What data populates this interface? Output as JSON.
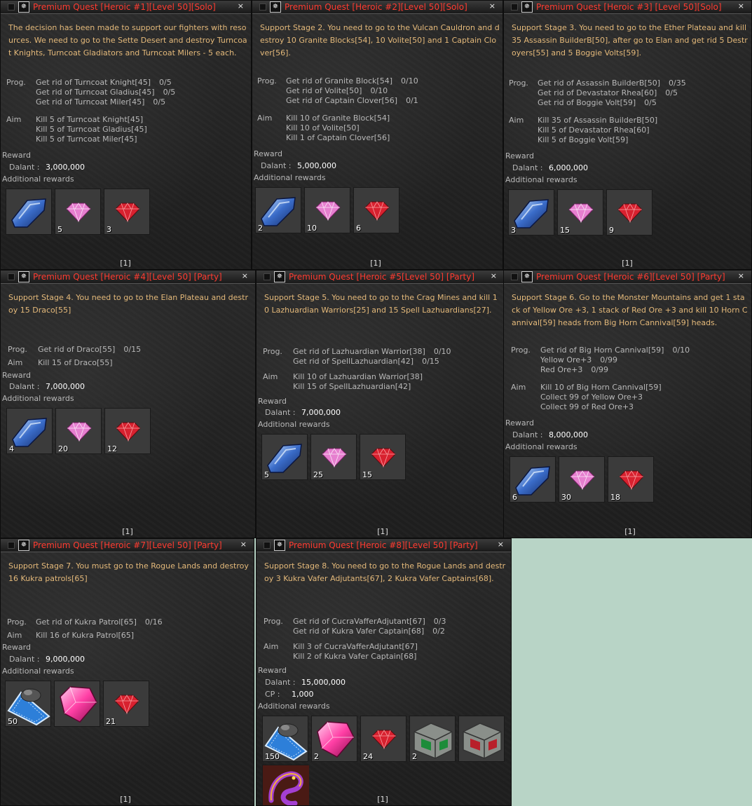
{
  "quests": [
    {
      "title": "Premium Quest [Heroic #1][Level 50][Solo]",
      "description": "The decision has been made to support our fighters with resources. We need to go to the Sette Desert and destroy Turncoat Knights, Turncoat Gladiators and Turncoat Milers - 5 each.",
      "prog_label": "Prog.",
      "progress": [
        {
          "text": "Get rid of Turncoat Knight[45]",
          "count": "0/5"
        },
        {
          "text": "Get rid of Turncoat Gladius[45]",
          "count": "0/5"
        },
        {
          "text": "Get rid of Turncoat Miler[45]",
          "count": "0/5"
        }
      ],
      "aim_label": "Aim",
      "aims": [
        "Kill 5 of Turncoat Knight[45]",
        "Kill 5 of Turncoat Gladius[45]",
        "Kill 5 of Turncoat Miler[45]"
      ],
      "reward_label": "Reward",
      "dalant_label": "Dalant :",
      "dalant": "3,000,000",
      "additional_label": "Additional rewards",
      "items": [
        {
          "icon": "blue-crystal-icon",
          "qty": ""
        },
        {
          "icon": "pink-gem-icon",
          "qty": "5"
        },
        {
          "icon": "red-gem-icon",
          "qty": "3"
        }
      ],
      "page": "[1]",
      "close": "×"
    },
    {
      "title": "Premium Quest [Heroic #2][Level 50][Solo]",
      "description": "Support Stage 2. You need to go to the Vulcan Cauldron and destroy 10 Granite Blocks[54], 10 Volite[50] and 1 Captain Clover[56].",
      "prog_label": "Prog.",
      "progress": [
        {
          "text": "Get rid of Granite Block[54]",
          "count": "0/10"
        },
        {
          "text": "Get rid of Volite[50]",
          "count": "0/10"
        },
        {
          "text": "Get rid of Captain Clover[56]",
          "count": "0/1"
        }
      ],
      "aim_label": "Aim",
      "aims": [
        "Kill 10 of Granite Block[54]",
        "Kill 10 of Volite[50]",
        "Kill 1 of Captain Clover[56]"
      ],
      "reward_label": "Reward",
      "dalant_label": "Dalant :",
      "dalant": "5,000,000",
      "additional_label": "Additional rewards",
      "items": [
        {
          "icon": "blue-crystal-icon",
          "qty": "2"
        },
        {
          "icon": "pink-gem-icon",
          "qty": "10"
        },
        {
          "icon": "red-gem-icon",
          "qty": "6"
        }
      ],
      "page": "[1]",
      "close": "×"
    },
    {
      "title": "Premium Quest [Heroic #3] [Level 50][Solo]",
      "description": "Support Stage 3. You need to go to the Ether Plateau and kill 35 Assassin BuilderB[50], after go to Elan and get rid 5 Destroyers[55] and 5 Boggie Volts[59].",
      "prog_label": "Prog.",
      "progress": [
        {
          "text": "Get rid of Assassin BuilderB[50]",
          "count": "0/35"
        },
        {
          "text": "Get rid of Devastator Rhea[60]",
          "count": "0/5"
        },
        {
          "text": "Get rid of Boggie Volt[59]",
          "count": "0/5"
        }
      ],
      "aim_label": "Aim",
      "aims": [
        "Kill 35 of Assassin BuilderB[50]",
        "Kill 5 of Devastator Rhea[60]",
        "Kill 5 of Boggie Volt[59]"
      ],
      "reward_label": "Reward",
      "dalant_label": "Dalant :",
      "dalant": "6,000,000",
      "additional_label": "Additional rewards",
      "items": [
        {
          "icon": "blue-crystal-icon",
          "qty": "3"
        },
        {
          "icon": "pink-gem-icon",
          "qty": "15"
        },
        {
          "icon": "red-gem-icon",
          "qty": "9"
        }
      ],
      "page": "[1]",
      "close": "×"
    },
    {
      "title": "Premium Quest [Heroic #4][Level 50] [Party]",
      "description": "Support Stage 4. You need to go to the Elan Plateau and destroy 15 Draco[55]",
      "prog_label": "Prog.",
      "progress": [
        {
          "text": "Get rid of Draco[55]",
          "count": "0/15"
        }
      ],
      "aim_label": "Aim",
      "aims": [
        "Kill 15 of Draco[55]"
      ],
      "reward_label": "Reward",
      "dalant_label": "Dalant :",
      "dalant": "7,000,000",
      "additional_label": "Additional rewards",
      "items": [
        {
          "icon": "blue-crystal-icon",
          "qty": "4"
        },
        {
          "icon": "pink-gem-icon",
          "qty": "20"
        },
        {
          "icon": "red-gem-icon",
          "qty": "12"
        }
      ],
      "page": "[1]",
      "close": "×"
    },
    {
      "title": "Premium Quest [Heroic #5[Level 50] [Party]",
      "description": "Support Stage 5. You need to go to the Crag Mines and kill 10 Lazhuardian Warriors[25] and 15 Spell Lazhuardians[27].",
      "prog_label": "Prog.",
      "progress": [
        {
          "text": "Get rid of Lazhuardian Warrior[38]",
          "count": "0/10"
        },
        {
          "text": "Get rid of SpellLazhuardian[42]",
          "count": "0/15"
        }
      ],
      "aim_label": "Aim",
      "aims": [
        "Kill 10 of Lazhuardian Warrior[38]",
        "Kill 15 of SpellLazhuardian[42]"
      ],
      "reward_label": "Reward",
      "dalant_label": "Dalant :",
      "dalant": "7,000,000",
      "additional_label": "Additional rewards",
      "items": [
        {
          "icon": "blue-crystal-icon",
          "qty": "5"
        },
        {
          "icon": "pink-gem-icon",
          "qty": "25"
        },
        {
          "icon": "red-gem-icon",
          "qty": "15"
        }
      ],
      "page": "[1]",
      "close": "×"
    },
    {
      "title": "Premium Quest [Heroic #6][Level 50] [Party]",
      "description": "Support Stage 6. Go to the Monster Mountains and get 1 stack of Yellow Ore +3, 1 stack of Red Ore +3 and kill 10 Horn Cannival[59] heads from Big Horn Cannival[59] heads.",
      "prog_label": "Prog.",
      "progress": [
        {
          "text": "Get rid of Big Horn Cannival[59]",
          "count": "0/10"
        },
        {
          "text": "Yellow Ore+3",
          "count": "0/99"
        },
        {
          "text": "Red Ore+3",
          "count": "0/99"
        }
      ],
      "aim_label": "Aim",
      "aims": [
        "Kill 10 of Big Horn Cannival[59]",
        "Collect 99 of Yellow Ore+3",
        "Collect 99 of Red Ore+3"
      ],
      "reward_label": "Reward",
      "dalant_label": "Dalant :",
      "dalant": "8,000,000",
      "additional_label": "Additional rewards",
      "items": [
        {
          "icon": "blue-crystal-icon",
          "qty": "6"
        },
        {
          "icon": "pink-gem-icon",
          "qty": "30"
        },
        {
          "icon": "red-gem-icon",
          "qty": "18"
        }
      ],
      "page": "[1]",
      "close": "×"
    },
    {
      "title": "Premium Quest [Heroic #7][Level 50] [Party]",
      "description": "Support Stage 7. You must go to the Rogue Lands and destroy 16 Kukra patrols[65]",
      "prog_label": "Prog.",
      "progress": [
        {
          "text": "Get rid of Kukra Patrol[65]",
          "count": "0/16"
        }
      ],
      "aim_label": "Aim",
      "aims": [
        "Kill 16 of Kukra Patrol[65]"
      ],
      "reward_label": "Reward",
      "dalant_label": "Dalant :",
      "dalant": "9,000,000",
      "additional_label": "Additional rewards",
      "items": [
        {
          "icon": "blue-ore-icon",
          "qty": "50"
        },
        {
          "icon": "large-pink-gem-icon",
          "qty": ""
        },
        {
          "icon": "red-gem-icon",
          "qty": "21"
        }
      ],
      "page": "[1]",
      "close": "×"
    },
    {
      "title": "Premium Quest [Heroic #8][Level 50] [Party]",
      "description": "Support Stage 8. You need to go to the Rogue Lands and destroy 3 Kukra Vafer Adjutants[67], 2 Kukra Vafer Captains[68].",
      "prog_label": "Prog.",
      "progress": [
        {
          "text": "Get rid of CucraVafferAdjutant[67]",
          "count": "0/3"
        },
        {
          "text": "Get rid of Kukra Vafer Captain[68]",
          "count": "0/2"
        }
      ],
      "aim_label": "Aim",
      "aims": [
        "Kill 3 of CucraVafferAdjutant[67]",
        "Kill 2 of Kukra Vafer Captain[68]"
      ],
      "reward_label": "Reward",
      "dalant_label": "Dalant :",
      "dalant": "15,000,000",
      "cp_label": "CP :",
      "cp": "1,000",
      "additional_label": "Additional rewards",
      "items": [
        {
          "icon": "blue-ore-icon",
          "qty": "150"
        },
        {
          "icon": "large-pink-gem-icon",
          "qty": "2"
        },
        {
          "icon": "red-gem-icon",
          "qty": "24"
        },
        {
          "icon": "green-chest-icon",
          "qty": "2"
        },
        {
          "icon": "red-chest-icon",
          "qty": ""
        },
        {
          "icon": "dragon-icon",
          "qty": ""
        }
      ],
      "page": "[1]",
      "close": "×"
    }
  ]
}
